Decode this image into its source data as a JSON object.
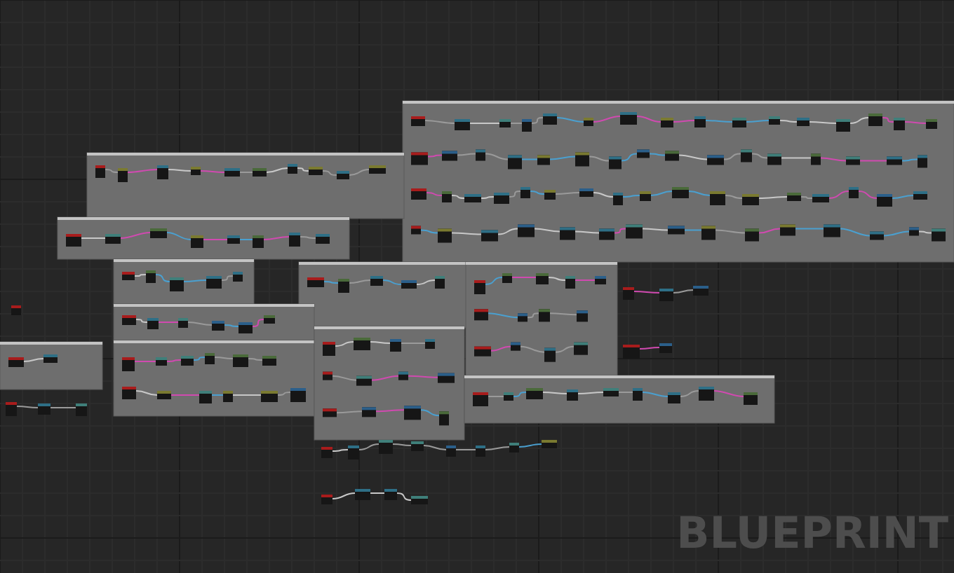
{
  "graph": {
    "corner_label": "BLUEPRINT"
  }
}
